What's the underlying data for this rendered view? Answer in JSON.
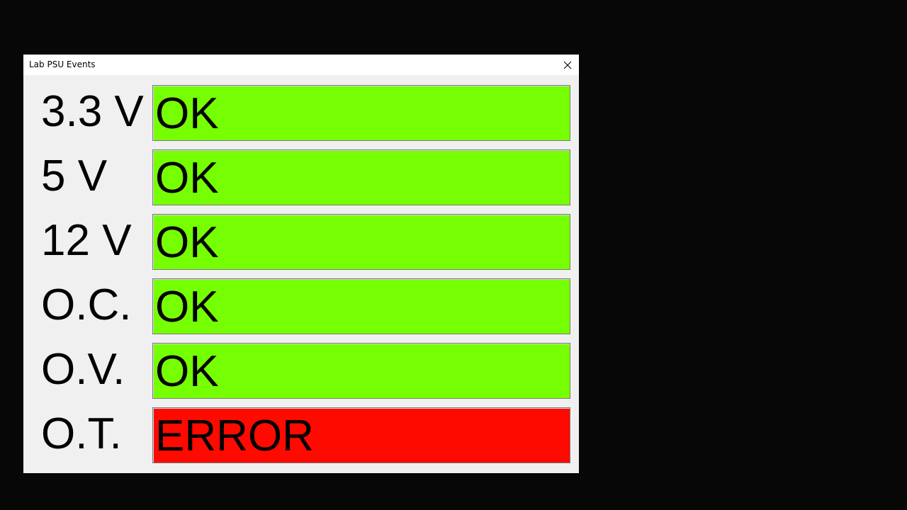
{
  "window": {
    "title": "Lab PSU Events",
    "close_icon": "close-icon"
  },
  "colors": {
    "ok": "#76ff03",
    "error": "#ff0a00",
    "desktop": "#070707",
    "window_bg": "#f0f0f0"
  },
  "rows": [
    {
      "label": "3.3 V",
      "status": "OK",
      "state": "ok"
    },
    {
      "label": "5 V",
      "status": "OK",
      "state": "ok"
    },
    {
      "label": "12 V",
      "status": "OK",
      "state": "ok"
    },
    {
      "label": "O.C.",
      "status": "OK",
      "state": "ok"
    },
    {
      "label": "O.V.",
      "status": "OK",
      "state": "ok"
    },
    {
      "label": "O.T.",
      "status": "ERROR",
      "state": "error"
    }
  ]
}
